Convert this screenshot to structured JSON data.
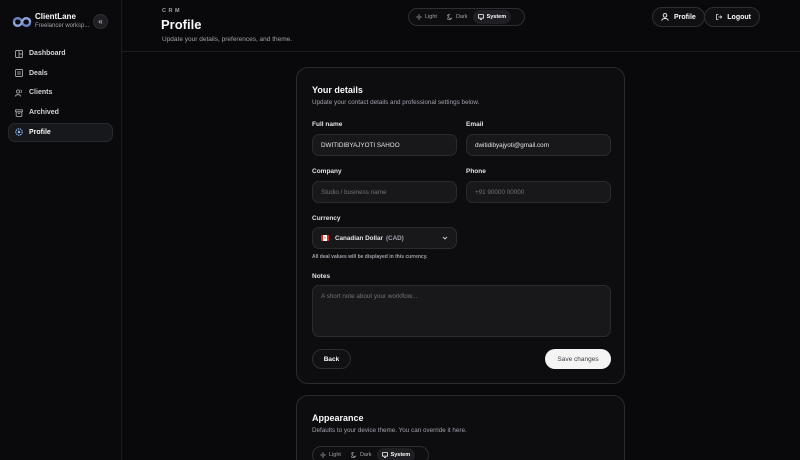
{
  "brand": {
    "name": "ClientLane",
    "tagline": "Freelancer worksp...",
    "logo_icon": "logo-icon"
  },
  "sidebar": {
    "collapse_icon": "chevrons-left-icon",
    "items": [
      {
        "label": "Dashboard",
        "icon": "dashboard-icon",
        "active": false
      },
      {
        "label": "Deals",
        "icon": "deals-icon",
        "active": false
      },
      {
        "label": "Clients",
        "icon": "users-icon",
        "active": false
      },
      {
        "label": "Archived",
        "icon": "archive-icon",
        "active": false
      },
      {
        "label": "Profile",
        "icon": "settings-icon",
        "active": true
      }
    ]
  },
  "header": {
    "kicker": "CRM",
    "title": "Profile",
    "subtitle": "Update your details, preferences, and theme.",
    "theme_options": [
      {
        "label": "Light",
        "icon": "sun-icon"
      },
      {
        "label": "Dark",
        "icon": "moon-icon"
      },
      {
        "label": "System",
        "icon": "monitor-icon"
      }
    ],
    "theme_selected": "System",
    "profile_label": "Profile",
    "logout_label": "Logout"
  },
  "details": {
    "title": "Your details",
    "description": "Update your contact details and professional settings below.",
    "full_name_label": "Full name",
    "full_name_value": "DWITIDIBYAJYOTI SAHOO",
    "email_label": "Email",
    "email_value": "dwitidibyajyoti@gmail.com",
    "company_label": "Company",
    "company_placeholder": "Studio / business name",
    "phone_label": "Phone",
    "phone_placeholder": "+91 90000 00000",
    "currency_label": "Currency",
    "currency_value": "Canadian Dollar",
    "currency_code": "(CAD)",
    "currency_hint": "All deal values will be displayed in this currency.",
    "notes_label": "Notes",
    "notes_placeholder": "A short note about your workflow...",
    "back_label": "Back",
    "save_label": "Save changes"
  },
  "appearance": {
    "title": "Appearance",
    "description": "Defaults to your device theme. You can override it here.",
    "theme_options": [
      {
        "label": "Light",
        "icon": "sun-icon"
      },
      {
        "label": "Dark",
        "icon": "moon-icon"
      },
      {
        "label": "System",
        "icon": "monitor-icon"
      }
    ],
    "theme_selected": "System"
  },
  "colors": {
    "background": "#09090b",
    "card": "#0d0d10",
    "field": "#18181b",
    "accent": "#f4f4f5",
    "flag_red": "#d52b1e"
  }
}
